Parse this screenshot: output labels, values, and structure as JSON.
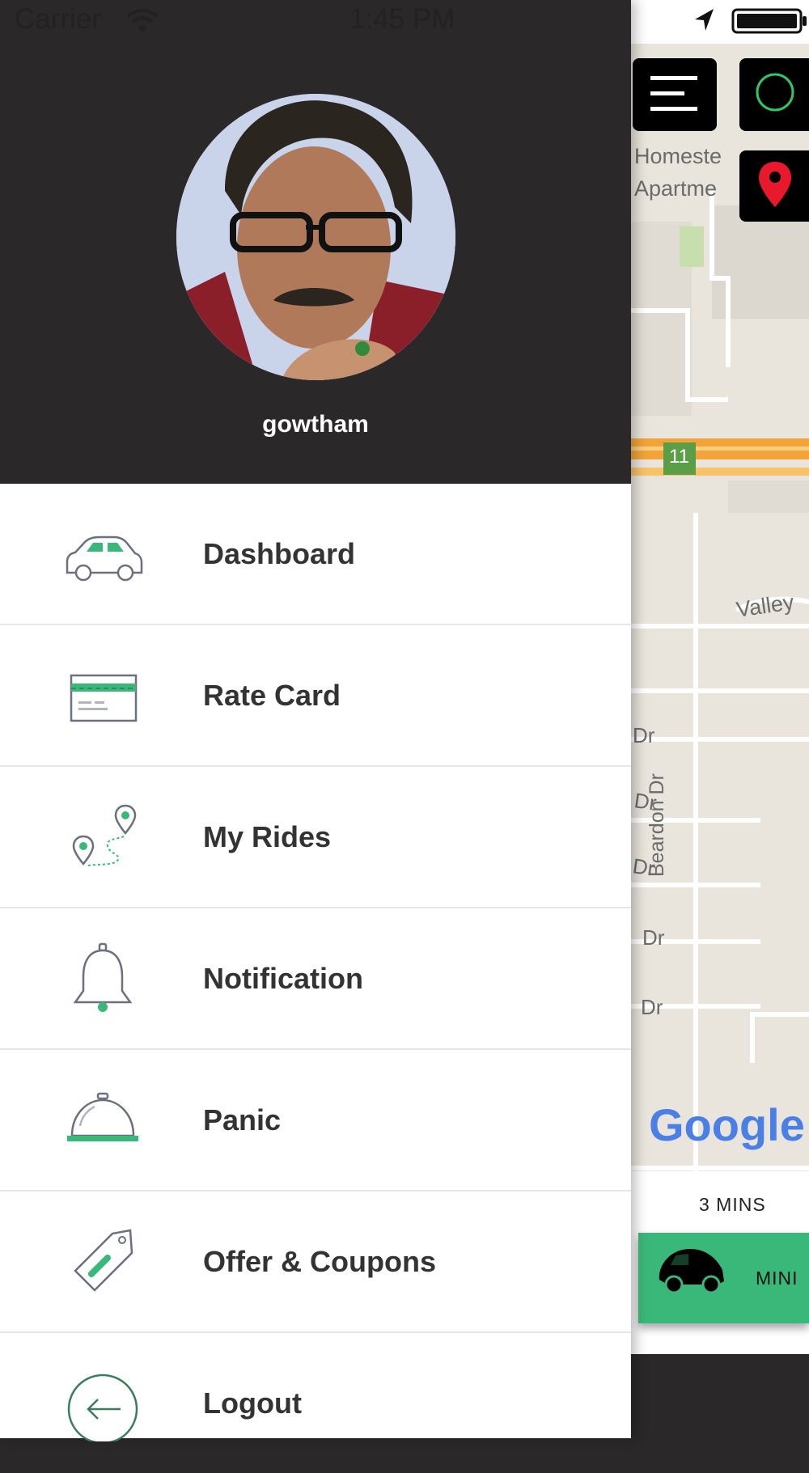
{
  "status_bar": {
    "carrier": "Carrier",
    "time": "1:45 PM"
  },
  "profile": {
    "username": "gowtham"
  },
  "menu": [
    {
      "label": "Dashboard",
      "icon": "car-icon"
    },
    {
      "label": "Rate Card",
      "icon": "card-icon"
    },
    {
      "label": "My Rides",
      "icon": "route-icon"
    },
    {
      "label": "Notification",
      "icon": "bell-icon"
    },
    {
      "label": "Panic",
      "icon": "service-bell-icon"
    },
    {
      "label": "Offer & Coupons",
      "icon": "tag-icon"
    },
    {
      "label": "Logout",
      "icon": "logout-icon"
    }
  ],
  "map": {
    "labels": {
      "homestead_1": "Homeste",
      "homestead_2": "Apartme",
      "valley": "Valley",
      "beardon": "Beardon Dr",
      "dr1": "Dr",
      "dr2": "Dr",
      "dr3": "Dr",
      "dr4": "Dr",
      "dr5": "Dr",
      "route": "11",
      "google": "Google"
    }
  },
  "ride": {
    "eta": "3 MINS",
    "type": "MINI"
  },
  "colors": {
    "accent": "#3ab87a",
    "header": "#2a2829",
    "pin": "#e8192c"
  }
}
